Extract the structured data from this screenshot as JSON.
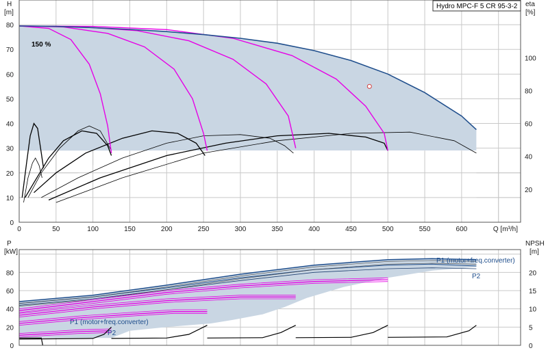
{
  "colors": {
    "envelope_fill": "#c9d6e3",
    "envelope_line": "#1f4e8c",
    "speed_curve": "#e600e6",
    "eta_curve": "#000000",
    "grid": "#c8c8c8"
  },
  "chart_data": [
    {
      "id": "qh",
      "type": "line",
      "title": "Hydro MPC-F 5 CR 95-3-2",
      "xlabel": "Q [m³/h]",
      "ylabel_left": "H\n[m]",
      "ylabel_right": "eta\n[%]",
      "x_ticks": [
        0,
        50,
        100,
        150,
        200,
        250,
        300,
        350,
        400,
        450,
        500,
        550,
        600,
        650
      ],
      "x_tick_labels": [
        "0",
        "50",
        "100",
        "150",
        "200",
        "250",
        "300",
        "350",
        "400",
        "450",
        "500",
        "550",
        "600"
      ],
      "xlim": [
        0,
        680
      ],
      "ylim": [
        0,
        90
      ],
      "y_ticks_left": [
        0,
        10,
        20,
        30,
        40,
        50,
        60,
        70,
        80
      ],
      "y2lim": [
        0,
        135
      ],
      "y_ticks_right": [
        20,
        40,
        60,
        80,
        100
      ],
      "speed_label": "150 %",
      "envelope": [
        [
          0,
          79.5
        ],
        [
          50,
          79.3
        ],
        [
          100,
          78.8
        ],
        [
          150,
          78.1
        ],
        [
          200,
          77.2
        ],
        [
          250,
          76.0
        ],
        [
          300,
          74.5
        ],
        [
          350,
          72.5
        ],
        [
          400,
          69.5
        ],
        [
          450,
          65.5
        ],
        [
          500,
          60.0
        ],
        [
          550,
          52.5
        ],
        [
          600,
          43.0
        ],
        [
          620,
          37.5
        ],
        [
          620,
          29
        ],
        [
          0,
          29
        ]
      ],
      "envelope_low": [
        [
          0,
          5
        ],
        [
          30,
          5
        ],
        [
          35,
          7
        ],
        [
          50,
          12
        ],
        [
          80,
          20
        ],
        [
          120,
          26
        ],
        [
          180,
          29
        ],
        [
          620,
          29
        ]
      ],
      "max_curve": [
        [
          0,
          79.5
        ],
        [
          50,
          79.3
        ],
        [
          100,
          78.8
        ],
        [
          150,
          78.1
        ],
        [
          200,
          77.2
        ],
        [
          250,
          76.0
        ],
        [
          300,
          74.5
        ],
        [
          350,
          72.5
        ],
        [
          400,
          69.5
        ],
        [
          450,
          65.5
        ],
        [
          500,
          60.0
        ],
        [
          550,
          52.5
        ],
        [
          600,
          43.0
        ],
        [
          620,
          37.5
        ]
      ],
      "duty_point": {
        "x": 475,
        "y": 55
      },
      "speed_curves": [
        [
          [
            0,
            79.5
          ],
          [
            40,
            78.5
          ],
          [
            70,
            74
          ],
          [
            95,
            64
          ],
          [
            110,
            52
          ],
          [
            120,
            39
          ],
          [
            125,
            28
          ]
        ],
        [
          [
            0,
            79.5
          ],
          [
            60,
            79.1
          ],
          [
            120,
            76.5
          ],
          [
            170,
            71
          ],
          [
            210,
            62
          ],
          [
            235,
            50
          ],
          [
            250,
            36
          ],
          [
            255,
            29
          ]
        ],
        [
          [
            0,
            79.5
          ],
          [
            80,
            79.2
          ],
          [
            160,
            77.6
          ],
          [
            230,
            73.5
          ],
          [
            290,
            66
          ],
          [
            335,
            56
          ],
          [
            365,
            43
          ],
          [
            375,
            30
          ]
        ],
        [
          [
            0,
            79.5
          ],
          [
            100,
            79.3
          ],
          [
            200,
            78.0
          ],
          [
            290,
            74.5
          ],
          [
            370,
            67.5
          ],
          [
            430,
            58
          ],
          [
            470,
            47
          ],
          [
            495,
            36
          ],
          [
            500,
            29
          ]
        ]
      ],
      "eta_curves": [
        [
          [
            4,
            10
          ],
          [
            10,
            24
          ],
          [
            15,
            35
          ],
          [
            20,
            40
          ],
          [
            25,
            38
          ],
          [
            30,
            28
          ],
          [
            33,
            22
          ]
        ],
        [
          [
            6,
            8
          ],
          [
            12,
            18
          ],
          [
            18,
            24
          ],
          [
            22,
            26
          ],
          [
            27,
            23
          ],
          [
            31,
            18
          ]
        ],
        [
          [
            8,
            10
          ],
          [
            20,
            16
          ],
          [
            40,
            26
          ],
          [
            60,
            33
          ],
          [
            85,
            37
          ],
          [
            105,
            36
          ],
          [
            120,
            31
          ],
          [
            125,
            27
          ]
        ],
        [
          [
            12,
            10
          ],
          [
            30,
            20
          ],
          [
            55,
            30
          ],
          [
            80,
            37
          ],
          [
            95,
            39
          ],
          [
            110,
            37
          ],
          [
            125,
            29
          ]
        ],
        [
          [
            20,
            12
          ],
          [
            50,
            20
          ],
          [
            90,
            28
          ],
          [
            140,
            34
          ],
          [
            180,
            37
          ],
          [
            215,
            36
          ],
          [
            240,
            32
          ],
          [
            252,
            27
          ]
        ],
        [
          [
            30,
            10
          ],
          [
            80,
            18
          ],
          [
            140,
            26
          ],
          [
            200,
            32
          ],
          [
            250,
            35
          ],
          [
            300,
            35.5
          ],
          [
            340,
            34
          ],
          [
            360,
            31
          ],
          [
            372,
            28
          ]
        ],
        [
          [
            40,
            9
          ],
          [
            110,
            18
          ],
          [
            200,
            27
          ],
          [
            280,
            32
          ],
          [
            350,
            35
          ],
          [
            420,
            36
          ],
          [
            470,
            34.5
          ],
          [
            495,
            32
          ],
          [
            500,
            29
          ]
        ],
        [
          [
            50,
            8
          ],
          [
            140,
            18
          ],
          [
            250,
            28
          ],
          [
            350,
            33
          ],
          [
            450,
            36
          ],
          [
            530,
            36.5
          ],
          [
            590,
            33
          ],
          [
            620,
            28
          ]
        ]
      ]
    },
    {
      "id": "power",
      "type": "line",
      "ylabel_left": "P\n[kW]",
      "ylabel_right": "NPSH\n[m]",
      "xlim": [
        0,
        680
      ],
      "ylim": [
        0,
        105
      ],
      "y_ticks_left": [
        0,
        20,
        40,
        60,
        80
      ],
      "y2lim": [
        0,
        26.25
      ],
      "y_ticks_right": [
        0,
        5,
        10,
        15,
        20
      ],
      "label_p1": "P1 (motor+freq.converter)",
      "label_p2": "P2",
      "envelope": [
        [
          0,
          48
        ],
        [
          100,
          55
        ],
        [
          200,
          66
        ],
        [
          300,
          78
        ],
        [
          400,
          88
        ],
        [
          500,
          94
        ],
        [
          560,
          95
        ],
        [
          620,
          94
        ],
        [
          620,
          86
        ],
        [
          560,
          82
        ],
        [
          500,
          74
        ],
        [
          440,
          64
        ],
        [
          390,
          52
        ],
        [
          360,
          42
        ],
        [
          330,
          34
        ],
        [
          290,
          28
        ],
        [
          260,
          24
        ],
        [
          200,
          20
        ],
        [
          150,
          16
        ],
        [
          125,
          8
        ],
        [
          0,
          8
        ]
      ],
      "p1_upper": [
        [
          0,
          48
        ],
        [
          100,
          55
        ],
        [
          200,
          66
        ],
        [
          300,
          78
        ],
        [
          400,
          88
        ],
        [
          500,
          94
        ],
        [
          560,
          95
        ],
        [
          620,
          94
        ]
      ],
      "p1_lower": [
        [
          0,
          46
        ],
        [
          100,
          53
        ],
        [
          200,
          63
        ],
        [
          300,
          74
        ],
        [
          400,
          83
        ],
        [
          500,
          88
        ],
        [
          560,
          89
        ],
        [
          620,
          87
        ]
      ],
      "p2_upper": [
        [
          0,
          44
        ],
        [
          100,
          51
        ],
        [
          200,
          61
        ],
        [
          300,
          71
        ],
        [
          400,
          80
        ],
        [
          500,
          84
        ],
        [
          560,
          85
        ],
        [
          620,
          84
        ]
      ],
      "speed_power": [
        [
          [
            0,
            11
          ],
          [
            40,
            13
          ],
          [
            80,
            15
          ],
          [
            125,
            16
          ]
        ],
        [
          [
            0,
            24
          ],
          [
            80,
            30
          ],
          [
            150,
            34
          ],
          [
            210,
            37
          ],
          [
            255,
            37
          ]
        ],
        [
          [
            0,
            33
          ],
          [
            100,
            42
          ],
          [
            200,
            49
          ],
          [
            300,
            53
          ],
          [
            375,
            53
          ]
        ],
        [
          [
            0,
            38
          ],
          [
            100,
            48
          ],
          [
            200,
            58
          ],
          [
            300,
            65
          ],
          [
            400,
            70
          ],
          [
            500,
            72
          ]
        ]
      ],
      "npsh": [
        [
          [
            0,
            2
          ],
          [
            30,
            2
          ],
          [
            32,
            0
          ]
        ],
        [
          [
            0,
            1.7
          ],
          [
            100,
            1.9
          ],
          [
            115,
            3
          ],
          [
            125,
            5
          ]
        ],
        [
          [
            125,
            1.9
          ],
          [
            200,
            2.0
          ],
          [
            230,
            3
          ],
          [
            255,
            5.5
          ]
        ],
        [
          [
            255,
            2.0
          ],
          [
            330,
            2.1
          ],
          [
            355,
            3.5
          ],
          [
            375,
            5.5
          ]
        ],
        [
          [
            375,
            2.1
          ],
          [
            450,
            2.2
          ],
          [
            480,
            3.5
          ],
          [
            500,
            5.5
          ]
        ],
        [
          [
            500,
            2.2
          ],
          [
            580,
            2.3
          ],
          [
            610,
            4
          ],
          [
            620,
            5.5
          ]
        ]
      ]
    }
  ]
}
